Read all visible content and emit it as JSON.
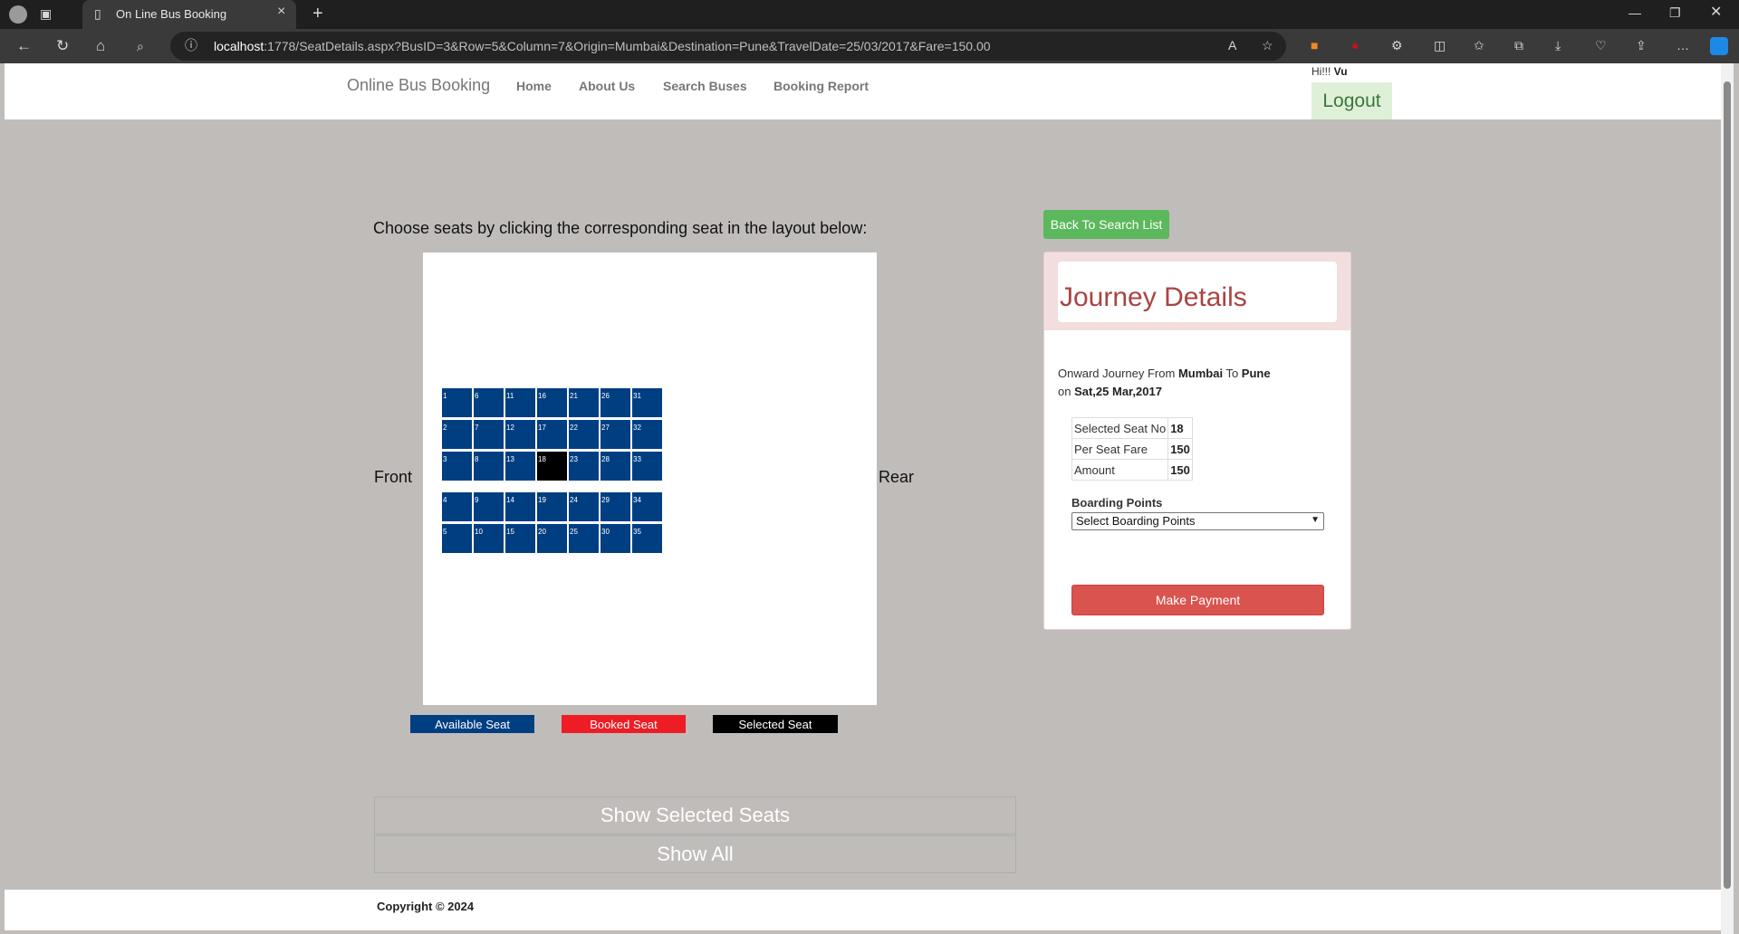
{
  "browser": {
    "tab_title": "On Line Bus Booking",
    "url_host": "localhost",
    "url_rest": ":1778/SeatDetails.aspx?BusID=3&Row=5&Column=7&Origin=Mumbai&Destination=Pune&TravelDate=25/03/2017&Fare=150.00"
  },
  "nav": {
    "brand": "Online Bus Booking",
    "links": [
      "Home",
      "About Us",
      "Search Buses",
      "Booking Report"
    ],
    "greeting": "Hi!!! ",
    "username": "Vu",
    "logout": "Logout"
  },
  "seats": {
    "instruction": "Choose seats by clicking the corresponding seat in the layout below:",
    "front_label": "Front",
    "rear_label": "Rear",
    "rows": [
      [
        "1",
        "6",
        "11",
        "16",
        "21",
        "26",
        "31"
      ],
      [
        "2",
        "7",
        "12",
        "17",
        "22",
        "27",
        "32"
      ],
      [
        "3",
        "8",
        "13",
        "18",
        "23",
        "28",
        "33"
      ],
      [
        "4",
        "9",
        "14",
        "19",
        "24",
        "29",
        "34"
      ],
      [
        "5",
        "10",
        "15",
        "20",
        "25",
        "30",
        "35"
      ]
    ],
    "selected_seat": "18",
    "legend": {
      "available": "Available Seat",
      "booked": "Booked Seat",
      "selected": "Selected Seat"
    },
    "colors": {
      "available": "#003e82",
      "booked": "#ee1c24",
      "selected": "#000000"
    },
    "show_selected": "Show Selected Seats",
    "show_all": "Show All"
  },
  "journey": {
    "back_button": "Back To Search List",
    "title": "Journey Details",
    "onward_prefix": "Onward Journey From ",
    "origin": "Mumbai",
    "to_word": " To ",
    "destination": "Pune",
    "on_word": "on ",
    "date": "Sat,25 Mar,2017",
    "fare_rows": [
      {
        "label": "Selected Seat No",
        "value": "18"
      },
      {
        "label": "Per Seat Fare",
        "value": "150"
      },
      {
        "label": "Amount",
        "value": "150"
      }
    ],
    "boarding_label": "Boarding Points",
    "boarding_selected": "Select Boarding Points",
    "pay_button": "Make Payment"
  },
  "footer": {
    "copyright": "Copyright © 2024"
  }
}
